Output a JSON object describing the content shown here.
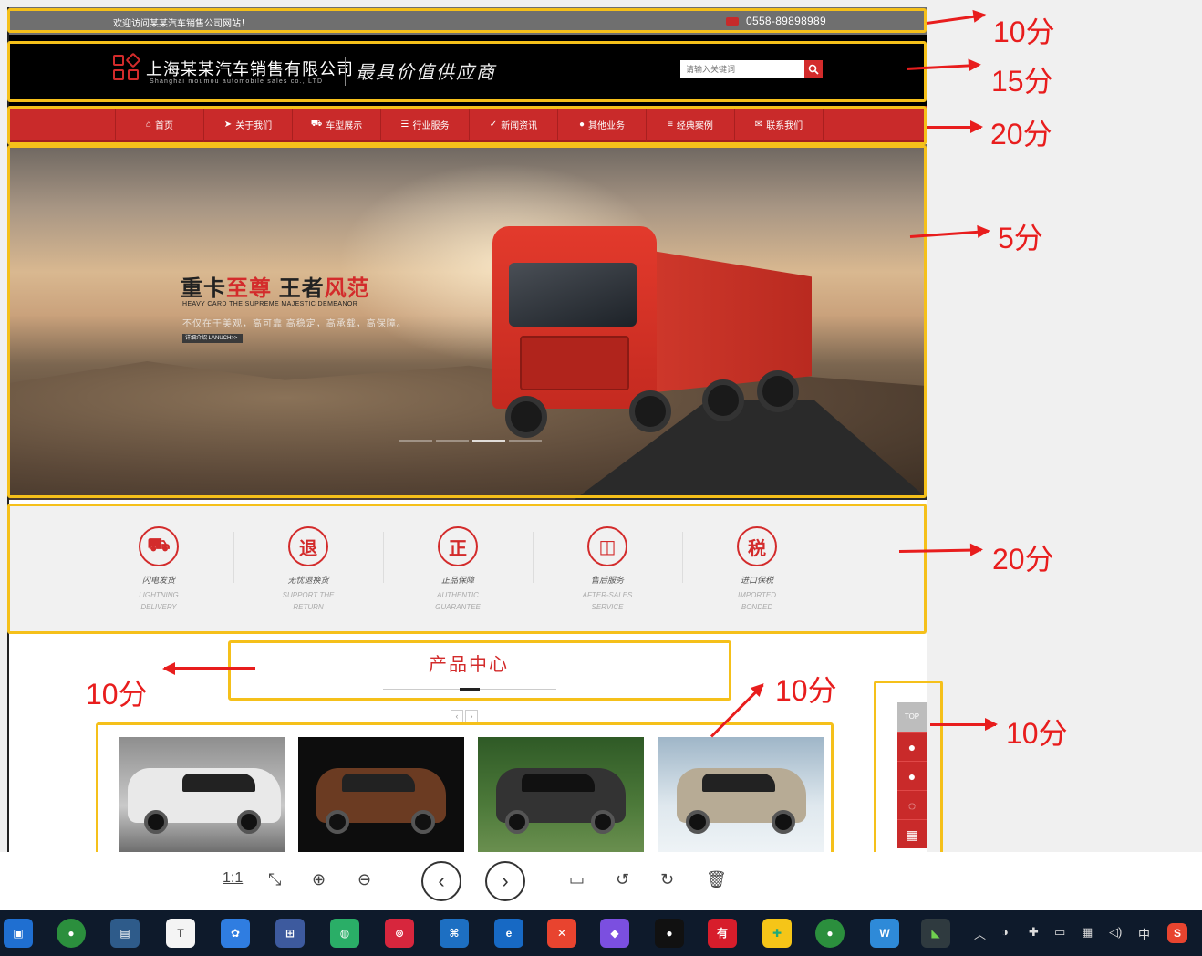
{
  "topbar": {
    "welcome": "欢迎访问某某汽车销售公司网站！",
    "phone": "0558-89898989"
  },
  "header": {
    "company": "上海某某汽车销售有限公司",
    "company_en": "Shanghai moumou automobile sales co., LTD",
    "slogan": "最具价值供应商",
    "search_placeholder": "请输入关键词"
  },
  "nav": [
    {
      "icon": "home-icon",
      "glyph": "⌂",
      "label": "首页"
    },
    {
      "icon": "send-icon",
      "glyph": "➤",
      "label": "关于我们"
    },
    {
      "icon": "truck-icon",
      "glyph": "⛟",
      "label": "车型展示"
    },
    {
      "icon": "list-icon",
      "glyph": "☰",
      "label": "行业服务"
    },
    {
      "icon": "cart-icon",
      "glyph": "✓",
      "label": "新闻资讯"
    },
    {
      "icon": "user-icon",
      "glyph": "●",
      "label": "其他业务"
    },
    {
      "icon": "list-icon",
      "glyph": "≡",
      "label": "经典案例"
    },
    {
      "icon": "chat-icon",
      "glyph": "✉",
      "label": "联系我们"
    }
  ],
  "banner": {
    "headline_a": "重卡",
    "headline_b": "至尊",
    "headline_c": " 王者",
    "headline_d": "风范",
    "sub_en": "HEAVY CARD THE SUPREME MAJESTIC DEMEANOR",
    "sub_cn": "不仅在于美观，高可靠 高稳定，高承载，高保障。",
    "more": "详细介绍 LANUCH>>"
  },
  "features": [
    {
      "icon": "delivery-icon",
      "glyph": "⛟",
      "cn": "闪电发货",
      "en1": "LIGHTNING",
      "en2": "DELIVERY"
    },
    {
      "icon": "return-icon",
      "glyph": "退",
      "cn": "无忧退换货",
      "en1": "SUPPORT THE",
      "en2": "RETURN"
    },
    {
      "icon": "authentic-icon",
      "glyph": "正",
      "cn": "正品保障",
      "en1": "AUTHENTIC",
      "en2": "GUARANTEE"
    },
    {
      "icon": "bag-icon",
      "glyph": "◫",
      "cn": "售后服务",
      "en1": "AFTER-SALES",
      "en2": "SERVICE"
    },
    {
      "icon": "tax-icon",
      "glyph": "税",
      "cn": "进口保税",
      "en1": "IMPORTED",
      "en2": "BONDED"
    }
  ],
  "products_title": "产品中心",
  "float_bar": {
    "top": "TOP"
  },
  "scores": [
    "10分",
    "15分",
    "20分",
    "5分",
    "20分",
    "10分",
    "10分",
    "10分"
  ],
  "viewer": {
    "ratio": "1:1"
  },
  "taskbar": {
    "lang": "中"
  }
}
